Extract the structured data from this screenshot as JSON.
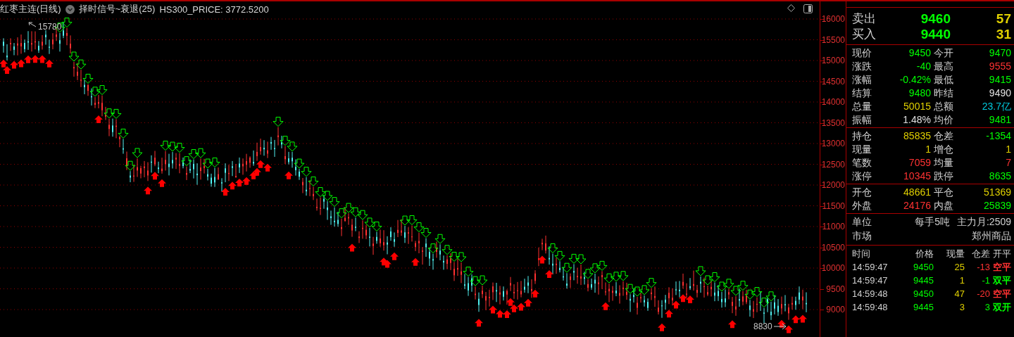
{
  "chart_header": {
    "symbol": "红枣主连(日线)",
    "indicator": "择时信号~衰退(25)",
    "extra": "HS300_PRICE: 3772.5200"
  },
  "chart": {
    "high_label": "15780",
    "low_label": "8830"
  },
  "y_axis": [
    "16000",
    "15500",
    "15000",
    "14500",
    "14000",
    "13500",
    "13000",
    "12500",
    "12000",
    "11500",
    "11000",
    "10500",
    "10000",
    "9500",
    "9000"
  ],
  "quote": [
    {
      "label": "卖出",
      "price": "9460",
      "size": "57"
    },
    {
      "label": "买入",
      "price": "9440",
      "size": "31"
    }
  ],
  "stat_groups": [
    {
      "items": [
        {
          "label": "现价",
          "value": "9450",
          "color": "#00ff00"
        },
        {
          "label": "今开",
          "value": "9470",
          "color": "#00ff00"
        },
        {
          "label": "涨跌",
          "value": "-40",
          "color": "#00ff00"
        },
        {
          "label": "最高",
          "value": "9555",
          "color": "#ff3232"
        },
        {
          "label": "涨幅",
          "value": "-0.42%",
          "color": "#00ff00"
        },
        {
          "label": "最低",
          "value": "9415",
          "color": "#00ff00"
        },
        {
          "label": "结算",
          "value": "9480",
          "color": "#00ff00"
        },
        {
          "label": "昨结",
          "value": "9490",
          "color": "#e0e0e0"
        },
        {
          "label": "总量",
          "value": "50015",
          "color": "#e0d000"
        },
        {
          "label": "总额",
          "value": "23.7亿",
          "color": "#00c8dc"
        },
        {
          "label": "振幅",
          "value": "1.48%",
          "color": "#e0e0e0"
        },
        {
          "label": "均价",
          "value": "9481",
          "color": "#00ff00"
        }
      ]
    },
    {
      "items": [
        {
          "label": "持仓",
          "value": "85835",
          "color": "#e0d000"
        },
        {
          "label": "仓差",
          "value": "-1354",
          "color": "#00ff00"
        },
        {
          "label": "现量",
          "value": "1",
          "color": "#e0d000"
        },
        {
          "label": "增仓",
          "value": "1",
          "color": "#e0d000"
        },
        {
          "label": "笔数",
          "value": "7059",
          "color": "#ff3232"
        },
        {
          "label": "均量",
          "value": "7",
          "color": "#ff3232"
        },
        {
          "label": "涨停",
          "value": "10345",
          "color": "#ff3232"
        },
        {
          "label": "跌停",
          "value": "8635",
          "color": "#00ff00"
        }
      ]
    },
    {
      "items": [
        {
          "label": "开仓",
          "value": "48661",
          "color": "#e0d000"
        },
        {
          "label": "平仓",
          "value": "51369",
          "color": "#e0d000"
        },
        {
          "label": "外盘",
          "value": "24176",
          "color": "#ff3232"
        },
        {
          "label": "内盘",
          "value": "25839",
          "color": "#00ff00"
        }
      ]
    }
  ],
  "info": [
    {
      "label": "单位",
      "values": [
        "每手5吨",
        "主力月:2509"
      ]
    },
    {
      "label": "市场",
      "values": [
        "郑州商品"
      ]
    }
  ],
  "trades": {
    "columns": [
      "时间",
      "价格",
      "现量",
      "仓差",
      "开平"
    ],
    "rows": [
      {
        "time": "14:59:47",
        "price": "9450",
        "volume": "25",
        "change": {
          "text": "-13",
          "color": "#ff3232"
        },
        "type": {
          "text": "空平",
          "color": "#ff3232"
        }
      },
      {
        "time": "14:59:47",
        "price": "9445",
        "volume": "1",
        "change": {
          "text": "-1",
          "color": "#00ff00"
        },
        "type": {
          "text": "双平",
          "color": "#00ff00"
        }
      },
      {
        "time": "14:59:48",
        "price": "9450",
        "volume": "47",
        "change": {
          "text": "-20",
          "color": "#ff3232"
        },
        "type": {
          "text": "空平",
          "color": "#ff3232"
        }
      },
      {
        "time": "14:59:48",
        "price": "9445",
        "volume": "3",
        "change": {
          "text": "3",
          "color": "#00ff00"
        },
        "type": {
          "text": "双开",
          "color": "#00ff00"
        }
      }
    ]
  }
}
